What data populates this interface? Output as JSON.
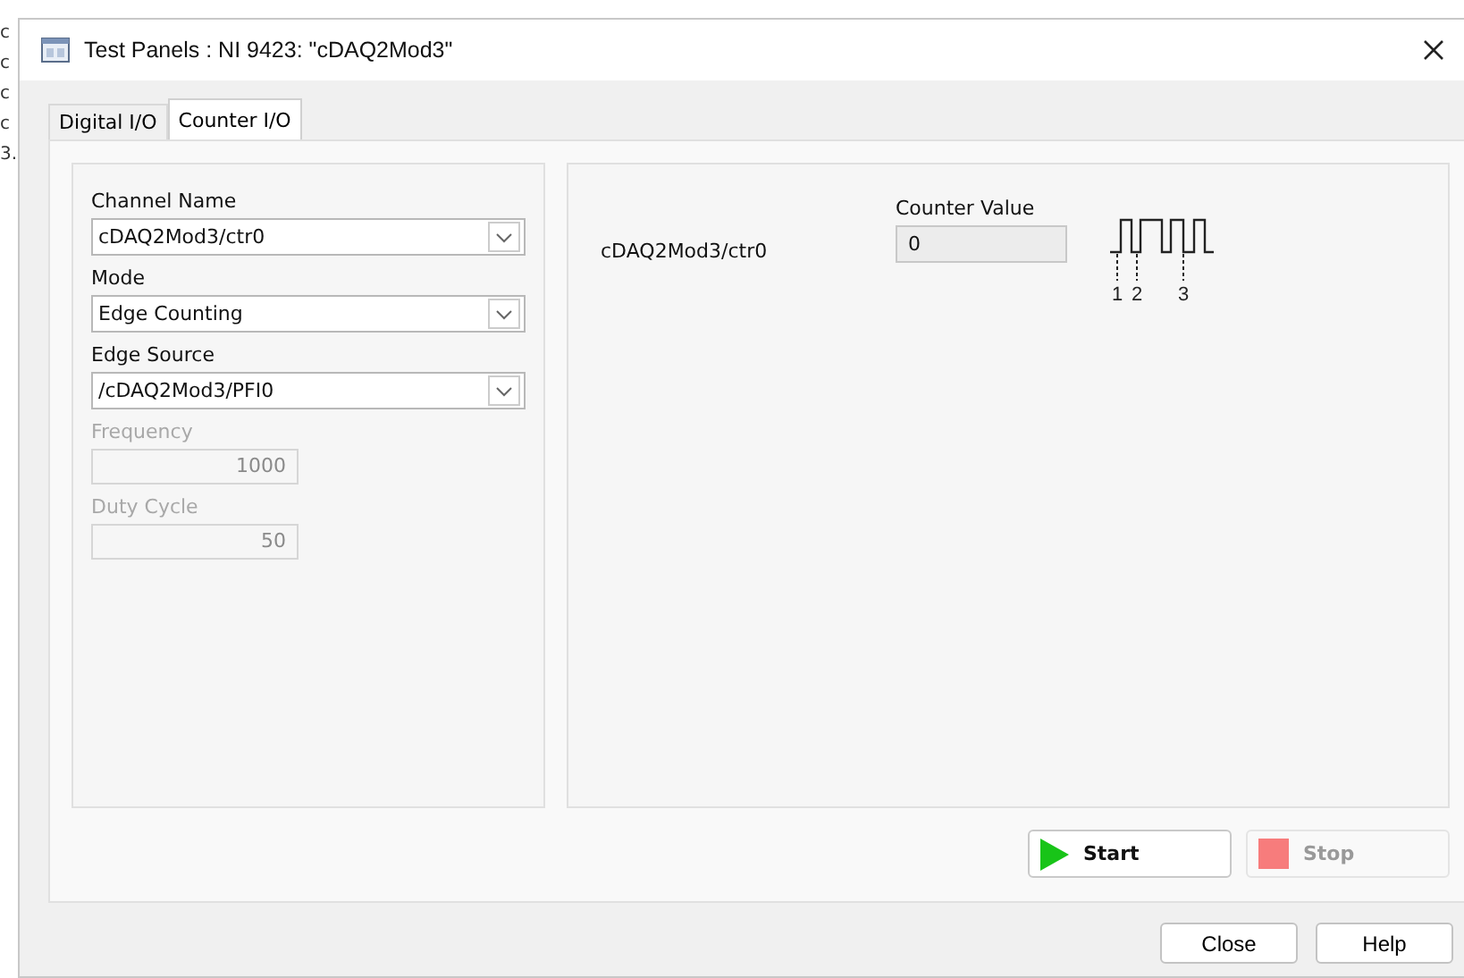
{
  "window": {
    "title": "Test Panels : NI 9423: \"cDAQ2Mod3\""
  },
  "background_lines": [
    "c",
    "c",
    "c",
    "c",
    "3."
  ],
  "tabs": [
    {
      "label": "Digital I/O",
      "selected": false
    },
    {
      "label": "Counter I/O",
      "selected": true
    }
  ],
  "settings": [
    {
      "kind": "dropdown",
      "label": "Channel Name",
      "value": "cDAQ2Mod3/ctr0",
      "disabled": false
    },
    {
      "kind": "dropdown",
      "label": "Mode",
      "value": "Edge Counting",
      "disabled": false
    },
    {
      "kind": "dropdown",
      "label": "Edge Source",
      "value": "/cDAQ2Mod3/PFI0",
      "disabled": false
    },
    {
      "kind": "numeric",
      "label": "Frequency",
      "value": "1000",
      "disabled": true
    },
    {
      "kind": "numeric",
      "label": "Duty Cycle",
      "value": "50",
      "disabled": true
    }
  ],
  "counter": {
    "channel": "cDAQ2Mod3/ctr0",
    "label": "Counter Value",
    "value": "0",
    "edge_marks": [
      "1",
      "2",
      "3"
    ]
  },
  "actions": [
    {
      "kind": "start",
      "label": "Start",
      "disabled": false
    },
    {
      "kind": "stop",
      "label": "Stop",
      "disabled": true
    }
  ],
  "footer_buttons": [
    "Close",
    "Help"
  ]
}
